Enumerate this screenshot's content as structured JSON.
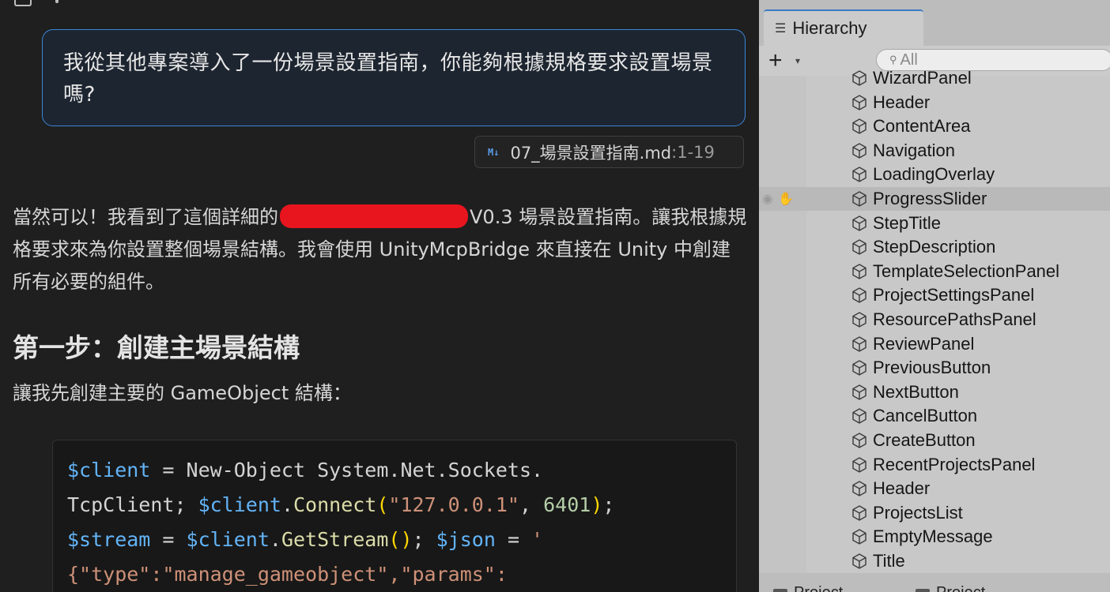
{
  "chat": {
    "user_message": "我從其他專案導入了一份場景設置指南，你能夠根據規格要求設置場景嗎?",
    "attachment": {
      "name": "07_場景設置指南.md",
      "range": ":1-19",
      "icon": "markdown-icon"
    },
    "reply_part1": "當然可以！我看到了這個詳細的",
    "reply_part2": "V0.3 場景設置指南。讓我根據規格要求來為你設置整個場景結構。我會使用 UnityMcpBridge 來直接在 Unity 中創建所有必要的組件。",
    "heading": "第一步：創建主場景結構",
    "intro": "讓我先創建主要的 GameObject 結構：",
    "code": {
      "l1_var": "$client",
      "l1_eq": " = ",
      "l1_rest": "New-Object System.Net.Sockets.",
      "l2_a": "TcpClient; ",
      "l2_var": "$client",
      "l2_dot": ".",
      "l2_fn": "Connect",
      "l2_open": "(",
      "l2_str": "\"127.0.0.1\"",
      "l2_comma": ", ",
      "l2_num": "6401",
      "l2_close": ")",
      "l2_semi": ";",
      "l3_var": "$stream",
      "l3_eq": " = ",
      "l3_var2": "$client",
      "l3_dot": ".",
      "l3_fn": "GetStream",
      "l3_paren": "()",
      "l3_semi": "; ",
      "l3_var3": "$json",
      "l3_eq2": " = ",
      "l3_str": "'",
      "l4_str": "{\"type\":\"manage_gameobject\",\"params\":"
    }
  },
  "hierarchy": {
    "tab_label": "Hierarchy",
    "add_label": "+",
    "search_placeholder": "All",
    "items": [
      {
        "label": "WizardPanel",
        "selected": false
      },
      {
        "label": "Header",
        "selected": false
      },
      {
        "label": "ContentArea",
        "selected": false
      },
      {
        "label": "Navigation",
        "selected": false
      },
      {
        "label": "LoadingOverlay",
        "selected": false
      },
      {
        "label": "ProgressSlider",
        "selected": true
      },
      {
        "label": "StepTitle",
        "selected": false
      },
      {
        "label": "StepDescription",
        "selected": false
      },
      {
        "label": "TemplateSelectionPanel",
        "selected": false
      },
      {
        "label": "ProjectSettingsPanel",
        "selected": false
      },
      {
        "label": "ResourcePathsPanel",
        "selected": false
      },
      {
        "label": "ReviewPanel",
        "selected": false
      },
      {
        "label": "PreviousButton",
        "selected": false
      },
      {
        "label": "NextButton",
        "selected": false
      },
      {
        "label": "CancelButton",
        "selected": false
      },
      {
        "label": "CreateButton",
        "selected": false
      },
      {
        "label": "RecentProjectsPanel",
        "selected": false
      },
      {
        "label": "Header",
        "selected": false
      },
      {
        "label": "ProjectsList",
        "selected": false
      },
      {
        "label": "EmptyMessage",
        "selected": false
      },
      {
        "label": "Title",
        "selected": false
      }
    ],
    "footer_tabs": [
      "Project",
      "Project"
    ]
  }
}
